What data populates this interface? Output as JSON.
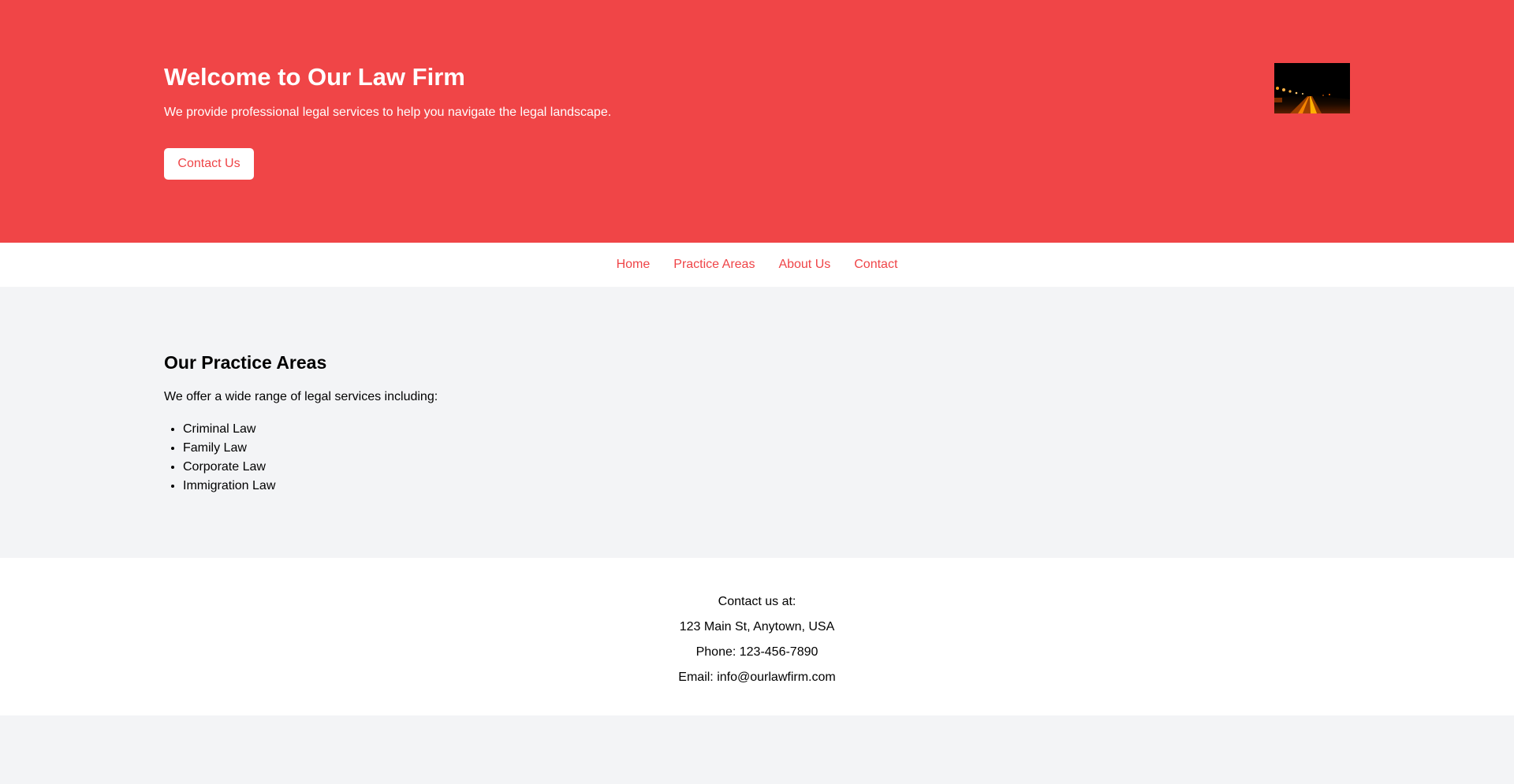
{
  "hero": {
    "title": "Welcome to Our Law Firm",
    "subtitle": "We provide professional legal services to help you navigate the legal landscape.",
    "button_label": "Contact Us",
    "image_alt": "night road with street lights"
  },
  "nav": {
    "items": [
      {
        "label": "Home"
      },
      {
        "label": "Practice Areas"
      },
      {
        "label": "About Us"
      },
      {
        "label": "Contact"
      }
    ]
  },
  "practice": {
    "title": "Our Practice Areas",
    "intro": "We offer a wide range of legal services including:",
    "items": [
      "Criminal Law",
      "Family Law",
      "Corporate Law",
      "Immigration Law"
    ]
  },
  "footer": {
    "heading": "Contact us at:",
    "address": "123 Main St, Anytown, USA",
    "phone": "Phone: 123-456-7890",
    "email": "Email: info@ourlawfirm.com"
  },
  "colors": {
    "hero_bg": "#f04547",
    "accent": "#ef4447",
    "page_bg": "#f3f4f6",
    "panel_bg": "#ffffff"
  }
}
